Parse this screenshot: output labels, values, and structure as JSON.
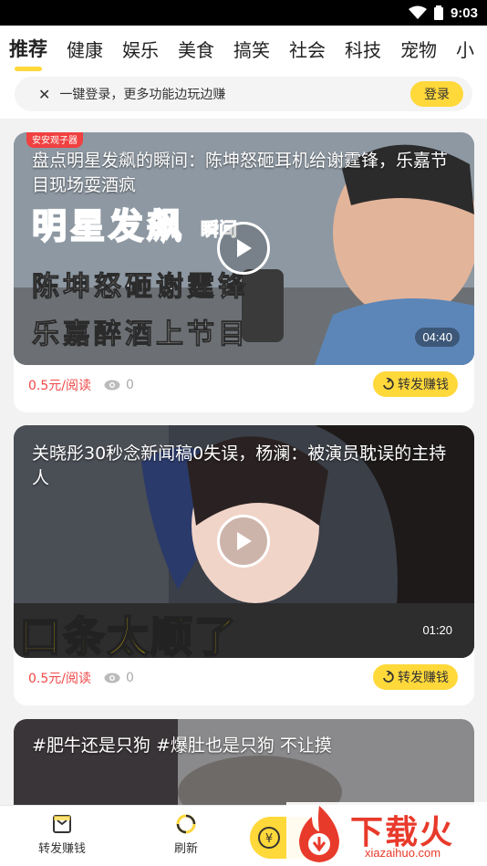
{
  "status": {
    "time": "9:03"
  },
  "tabs": [
    "推荐",
    "健康",
    "娱乐",
    "美食",
    "搞笑",
    "社会",
    "科技",
    "宠物",
    "小"
  ],
  "login": {
    "text": "一键登录，更多功能边玩边赚",
    "button": "登录"
  },
  "videos": [
    {
      "title": "盘点明星发飙的瞬间：陈坤怒砸耳机给谢霆锋，乐嘉节目现场耍酒疯",
      "badge": "安安观子器",
      "overlay_lines": [
        "明星发飙",
        "瞬间",
        "陈坤怒砸谢霆锋",
        "乐嘉醉酒上节目"
      ],
      "duration": "04:40",
      "price": "0.5元/阅读",
      "views": "0",
      "share": "转发赚钱"
    },
    {
      "title": "关晓彤30秒念新闻稿0失误，杨澜：被演员耽误的主持人",
      "overlay_lines": [
        "口条太顺了"
      ],
      "duration": "01:20",
      "price": "0.5元/阅读",
      "views": "0",
      "share": "转发赚钱"
    },
    {
      "title": "#肥牛还是只狗 #爆肚也是只狗 不让摸"
    }
  ],
  "bottom_nav": {
    "share_earn": "转发赚钱",
    "refresh": "刷新"
  },
  "watermark": {
    "text": "下载火",
    "url": "xiazaihuo.com"
  },
  "colors": {
    "accent": "#ffd83a",
    "price": "#f04848",
    "watermark": "#e83a2b"
  }
}
